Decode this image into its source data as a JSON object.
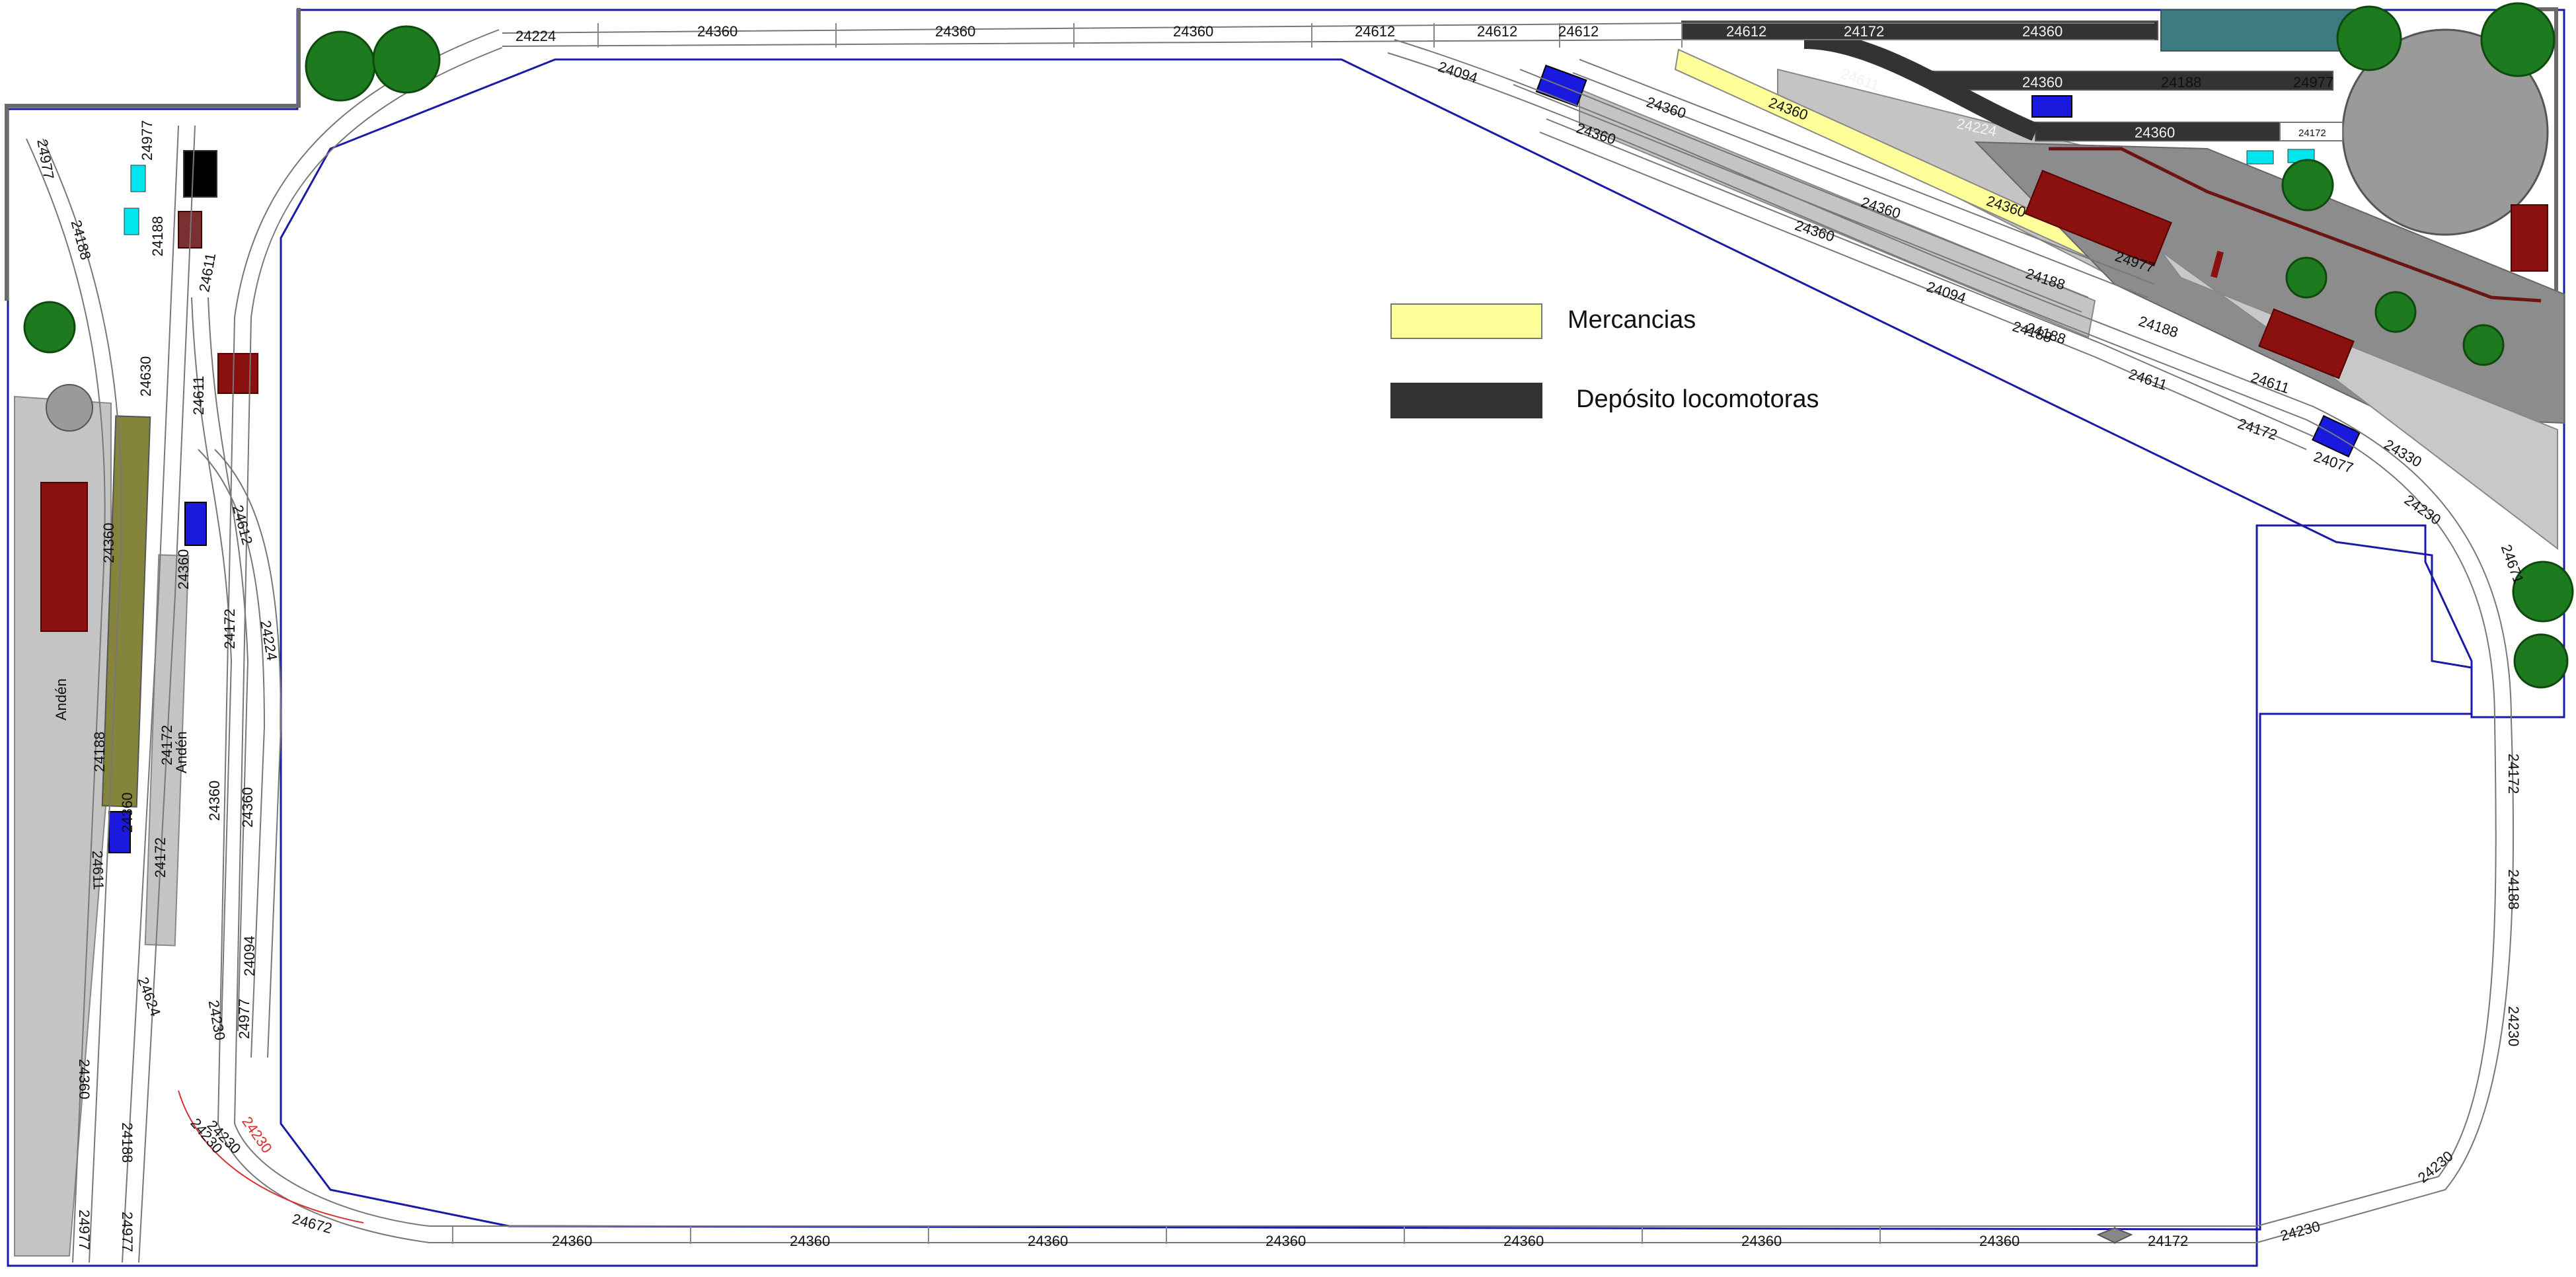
{
  "legend": [
    {
      "label": "Mercancias",
      "color": "#ffff99"
    },
    {
      "label": "Depósito locomotoras",
      "color": "#333333"
    }
  ],
  "platform_label": "Andén",
  "colors": {
    "board_outline": "#1a1aa6",
    "track_stroke": "#777777",
    "platform_gray": "#c4c4c4",
    "dark_gray": "#8c8c8c",
    "olive": "#84843c",
    "building_red": "#8b1010",
    "signal_blue": "#1a1adf",
    "tree_green": "#1e7a1e",
    "turntable": "#9a9a9a",
    "loco_teal": "#3c7c80",
    "red_track_label": "#d83030"
  },
  "track_labels": {
    "top_main": [
      "24224",
      "24360",
      "24360",
      "24360",
      "24612",
      "24612",
      "24612"
    ],
    "depot": [
      "24612",
      "24172",
      "24360",
      "24360",
      "24188",
      "24977",
      "24611",
      "24224",
      "24360",
      "24172"
    ],
    "top_diagonal": [
      "24094",
      "24360",
      "24360",
      "24360",
      "24360",
      "24360",
      "24360",
      "24094",
      "24188",
      "24188",
      "24977",
      "24188",
      "24188",
      "24611",
      "24611",
      "24172",
      "24077",
      "24330",
      "24230"
    ],
    "right_side": [
      "24671",
      "24172",
      "24188",
      "24230",
      "24230"
    ],
    "bottom_main": [
      "24360",
      "24360",
      "24360",
      "24360",
      "24360",
      "24360",
      "24360",
      "24172",
      "24230"
    ],
    "bottom_left": [
      "24672",
      "24230",
      "24230"
    ],
    "left_outer": [
      "24977",
      "24188",
      "24611",
      "24360",
      "24977",
      "24360",
      "24188",
      "24977",
      "24188"
    ],
    "left_inner": [
      "24977",
      "24188",
      "24611",
      "24611",
      "24630",
      "24612",
      "24224",
      "24360",
      "24360",
      "24172",
      "24172",
      "24172",
      "24360",
      "24360",
      "24094",
      "24230",
      "24977",
      "24624",
      "24230"
    ]
  }
}
